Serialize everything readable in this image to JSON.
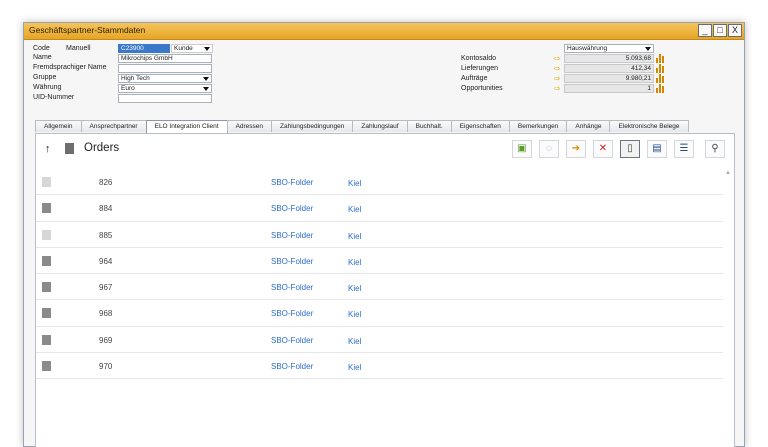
{
  "window": {
    "title": "Geschäftspartner-Stammdaten",
    "buttons": [
      "_",
      "□",
      "X"
    ]
  },
  "header": {
    "code_label": "Code",
    "code_mode": "Manuell",
    "code_value": "C23900",
    "code_type": "Kunde",
    "name_label": "Name",
    "name_value": "Mikrochips GmbH",
    "foreign_name_label": "Fremdsprachiger Name",
    "foreign_name_value": "",
    "group_label": "Gruppe",
    "group_value": "High Tech",
    "currency_label": "Währung",
    "currency_value": "Euro",
    "uid_label": "UID-Nummer",
    "uid_value": ""
  },
  "balances": {
    "currency_select": "Hauswährung",
    "rows": [
      {
        "label": "Kontosaldo",
        "value": "5.093,68"
      },
      {
        "label": "Lieferungen",
        "value": "412,34"
      },
      {
        "label": "Aufträge",
        "value": "9.980,21"
      },
      {
        "label": "Opportunities",
        "value": "1"
      }
    ]
  },
  "tabs": [
    {
      "label": "Allgemein",
      "active": false
    },
    {
      "label": "Ansprechpartner",
      "active": false
    },
    {
      "label": "ELO Integration Client",
      "active": true
    },
    {
      "label": "Adressen",
      "active": false
    },
    {
      "label": "Zahlungsbedingungen",
      "active": false
    },
    {
      "label": "Zahlungslauf",
      "active": false
    },
    {
      "label": "Buchhalt.",
      "active": false
    },
    {
      "label": "Eigenschaften",
      "active": false
    },
    {
      "label": "Bemerkungen",
      "active": false
    },
    {
      "label": "Anhänge",
      "active": false
    },
    {
      "label": "Elektronische Belege",
      "active": false
    }
  ],
  "panel": {
    "title": "Orders",
    "toolbar_icons": [
      "new-document-icon",
      "attach-icon",
      "move-icon",
      "delete-icon",
      "page-icon",
      "view-icon",
      "list-icon",
      "search-icon"
    ],
    "rows": [
      {
        "id": "826",
        "folder": "SBO-Folder",
        "location": "Kiel",
        "icon": "document-light-icon"
      },
      {
        "id": "884",
        "folder": "SBO-Folder",
        "location": "Kiel",
        "icon": "document-icon"
      },
      {
        "id": "885",
        "folder": "SBO-Folder",
        "location": "Kiel",
        "icon": "document-light-icon"
      },
      {
        "id": "964",
        "folder": "SBO-Folder",
        "location": "Kiel",
        "icon": "document-icon"
      },
      {
        "id": "967",
        "folder": "SBO-Folder",
        "location": "Kiel",
        "icon": "document-icon"
      },
      {
        "id": "968",
        "folder": "SBO-Folder",
        "location": "Kiel",
        "icon": "document-icon"
      },
      {
        "id": "969",
        "folder": "SBO-Folder",
        "location": "Kiel",
        "icon": "document-icon"
      },
      {
        "id": "970",
        "folder": "SBO-Folder",
        "location": "Kiel",
        "icon": "document-icon"
      }
    ]
  },
  "colors": {
    "titlebar": "#e6a526",
    "link": "#2b6cc7",
    "selection": "#3a78c9"
  }
}
